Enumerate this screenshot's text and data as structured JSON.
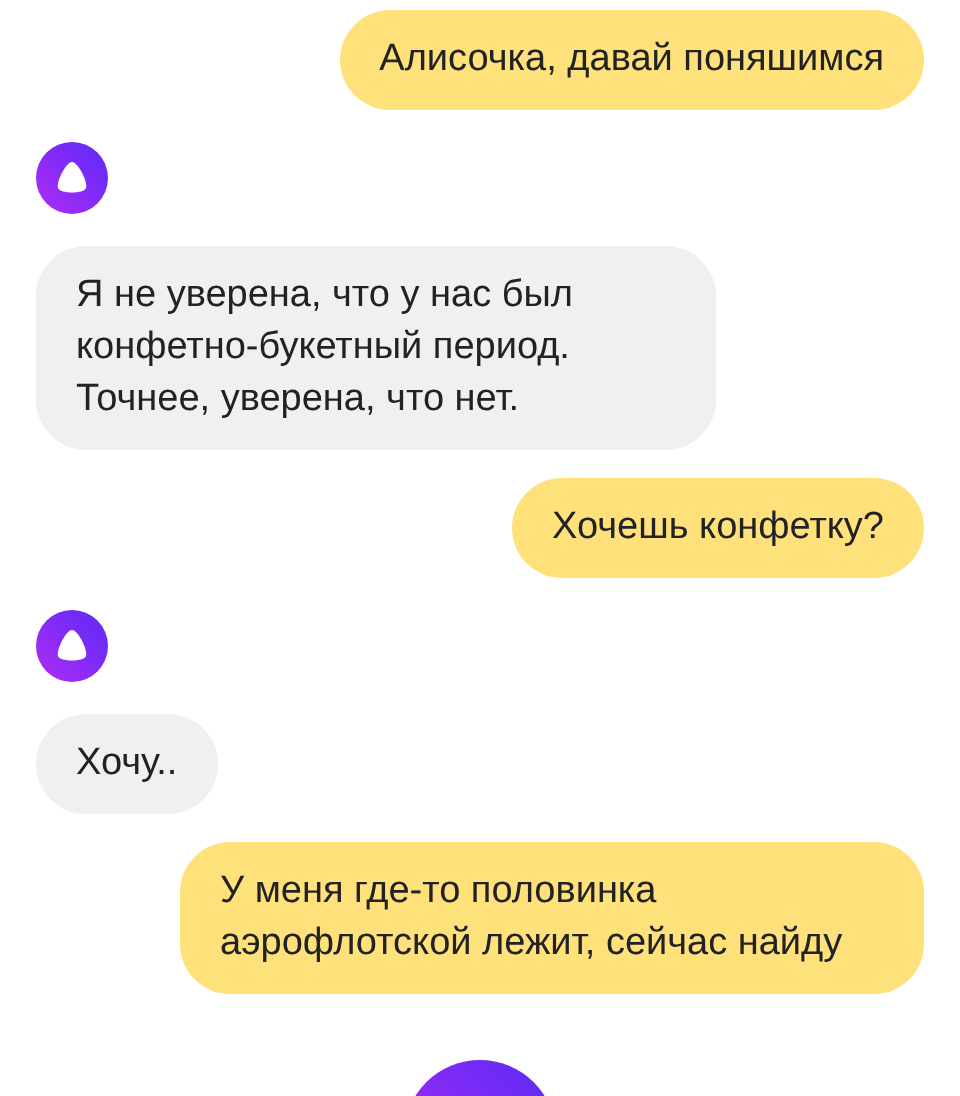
{
  "messages": [
    {
      "kind": "user",
      "text": "Алисочка, давай поняшимся"
    },
    {
      "kind": "assistant",
      "text": "Я не уверена, что у нас был конфетно-букетный период. Точнее, уверена, что нет."
    },
    {
      "kind": "user",
      "text": "Хочешь конфетку?"
    },
    {
      "kind": "assistant",
      "text": "Хочу.."
    },
    {
      "kind": "user",
      "text": "У меня где-то половинка аэрофлотской лежит, сейчас найду"
    }
  ]
}
